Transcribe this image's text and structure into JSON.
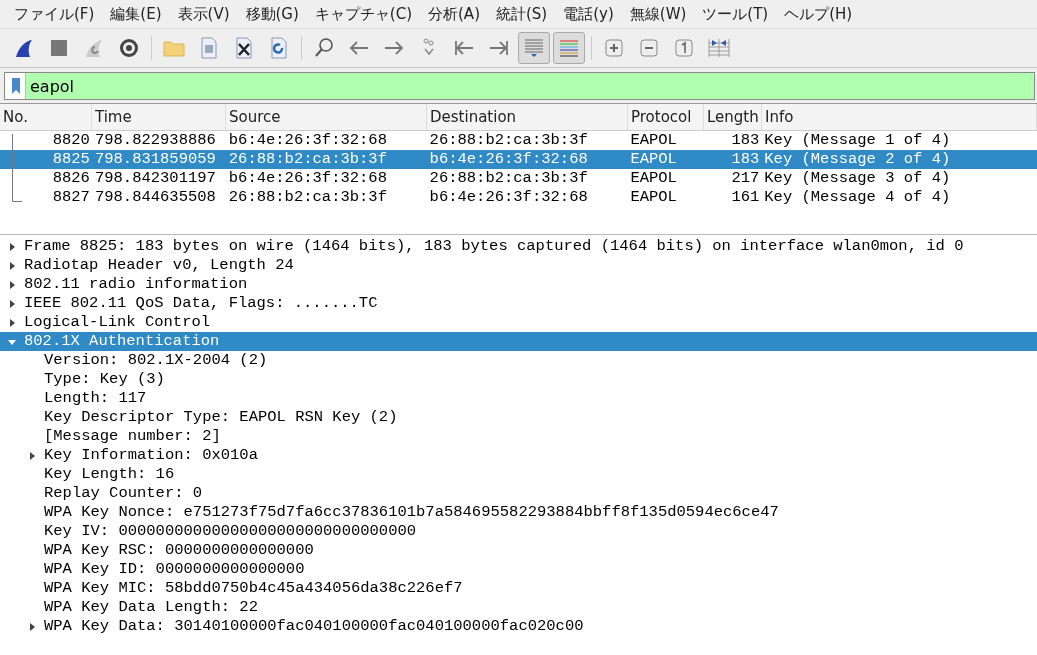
{
  "menu": [
    "ファイル(F)",
    "編集(E)",
    "表示(V)",
    "移動(G)",
    "キャプチャ(C)",
    "分析(A)",
    "統計(S)",
    "電話(y)",
    "無線(W)",
    "ツール(T)",
    "ヘルプ(H)"
  ],
  "toolbar": [
    {
      "kind": "shark",
      "pressed": false
    },
    {
      "kind": "stop",
      "pressed": false
    },
    {
      "kind": "restart",
      "pressed": false
    },
    {
      "kind": "options",
      "pressed": false
    },
    {
      "kind": "sep"
    },
    {
      "kind": "folder",
      "pressed": false
    },
    {
      "kind": "file",
      "pressed": false
    },
    {
      "kind": "close",
      "pressed": false
    },
    {
      "kind": "reload",
      "pressed": false
    },
    {
      "kind": "sep"
    },
    {
      "kind": "find",
      "pressed": false
    },
    {
      "kind": "back",
      "pressed": false
    },
    {
      "kind": "forward",
      "pressed": false
    },
    {
      "kind": "goto",
      "pressed": false
    },
    {
      "kind": "first",
      "pressed": false
    },
    {
      "kind": "last",
      "pressed": false
    },
    {
      "kind": "autoscroll",
      "pressed": true
    },
    {
      "kind": "colorize",
      "pressed": true
    },
    {
      "kind": "sep"
    },
    {
      "kind": "zoomin",
      "pressed": false
    },
    {
      "kind": "zoomout",
      "pressed": false
    },
    {
      "kind": "zoomreset",
      "pressed": false
    },
    {
      "kind": "resize",
      "pressed": false
    }
  ],
  "filter": {
    "value": "eapol"
  },
  "packet_list": {
    "columns": [
      "No.",
      "Time",
      "Source",
      "Destination",
      "Protocol",
      "Length",
      "Info"
    ],
    "rows": [
      {
        "cells": [
          "8820",
          "798.822938886",
          "b6:4e:26:3f:32:68",
          "26:88:b2:ca:3b:3f",
          "EAPOL",
          "183",
          "Key (Message 1 of 4)"
        ],
        "selected": false
      },
      {
        "cells": [
          "8825",
          "798.831859059",
          "26:88:b2:ca:3b:3f",
          "b6:4e:26:3f:32:68",
          "EAPOL",
          "183",
          "Key (Message 2 of 4)"
        ],
        "selected": true
      },
      {
        "cells": [
          "8826",
          "798.842301197",
          "b6:4e:26:3f:32:68",
          "26:88:b2:ca:3b:3f",
          "EAPOL",
          "217",
          "Key (Message 3 of 4)"
        ],
        "selected": false
      },
      {
        "cells": [
          "8827",
          "798.844635508",
          "26:88:b2:ca:3b:3f",
          "b6:4e:26:3f:32:68",
          "EAPOL",
          "161",
          "Key (Message 4 of 4)"
        ],
        "selected": false
      }
    ]
  },
  "details": [
    {
      "text": "Frame 8825: 183 bytes on wire (1464 bits), 183 bytes captured (1464 bits) on interface wlan0mon, id 0",
      "expanded": false,
      "selected": false
    },
    {
      "text": "Radiotap Header v0, Length 24",
      "expanded": false,
      "selected": false
    },
    {
      "text": "802.11 radio information",
      "expanded": false,
      "selected": false
    },
    {
      "text": "IEEE 802.11 QoS Data, Flags: .......TC",
      "expanded": false,
      "selected": false
    },
    {
      "text": "Logical-Link Control",
      "expanded": false,
      "selected": false
    },
    {
      "text": "802.1X Authentication",
      "expanded": true,
      "selected": true,
      "children": [
        {
          "text": "Version: 802.1X-2004 (2)",
          "selected": false
        },
        {
          "text": "Type: Key (3)",
          "selected": false
        },
        {
          "text": "Length: 117",
          "selected": false
        },
        {
          "text": "Key Descriptor Type: EAPOL RSN Key (2)",
          "selected": false
        },
        {
          "text": "[Message number: 2]",
          "selected": false
        },
        {
          "text": "Key Information: 0x010a",
          "expanded": false,
          "selected": false
        },
        {
          "text": "Key Length: 16",
          "selected": false
        },
        {
          "text": "Replay Counter: 0",
          "selected": false
        },
        {
          "text": "WPA Key Nonce: e751273f75d7fa6cc37836101b7a584695582293884bbff8f135d0594ec6ce47",
          "selected": false
        },
        {
          "text": "Key IV: 00000000000000000000000000000000",
          "selected": false
        },
        {
          "text": "WPA Key RSC: 0000000000000000",
          "selected": false
        },
        {
          "text": "WPA Key ID: 0000000000000000",
          "selected": false
        },
        {
          "text": "WPA Key MIC: 58bdd0750b4c45a434056da38c226ef7",
          "selected": false
        },
        {
          "text": "WPA Key Data Length: 22",
          "selected": false
        },
        {
          "text": "WPA Key Data: 30140100000fac040100000fac040100000fac020c00",
          "expanded": false,
          "selected": false
        }
      ]
    }
  ]
}
